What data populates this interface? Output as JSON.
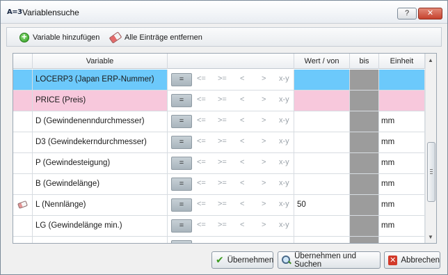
{
  "window": {
    "app_icon": "A=3",
    "title": "Variablensuche",
    "help_label": "?",
    "close_label": "✕"
  },
  "toolbar": {
    "add_label": "Variable hinzufügen",
    "add_icon": "add-circle-icon",
    "clear_label": "Alle Einträge entfernen",
    "clear_icon": "eraser-icon"
  },
  "grid": {
    "headers": {
      "variable": "Variable",
      "von": "Wert / von",
      "bis": "bis",
      "unit": "Einheit"
    },
    "ops": {
      "eq": "=",
      "le": "<=",
      "ge": ">=",
      "lt": "<",
      "gt": ">",
      "range": "x-y"
    },
    "rows": [
      {
        "variable": "LOCERP3 (Japan ERP-Nummer)",
        "von": "",
        "unit": "",
        "state": "selected"
      },
      {
        "variable": "PRICE (Preis)",
        "von": "",
        "unit": "",
        "state": "highlighted"
      },
      {
        "variable": "D (Gewindenenndurchmesser)",
        "von": "",
        "unit": "mm",
        "state": "normal"
      },
      {
        "variable": "D3 (Gewindekerndurchmesser)",
        "von": "",
        "unit": "mm",
        "state": "normal"
      },
      {
        "variable": "P (Gewindesteigung)",
        "von": "",
        "unit": "mm",
        "state": "normal"
      },
      {
        "variable": "B (Gewindelänge)",
        "von": "",
        "unit": "mm",
        "state": "normal"
      },
      {
        "variable": "L (Nennlänge)",
        "von": "50",
        "unit": "mm",
        "state": "normal",
        "icon": "eraser-icon"
      },
      {
        "variable": "LG (Gewindelänge min.)",
        "von": "",
        "unit": "mm",
        "state": "normal"
      }
    ]
  },
  "buttons": {
    "apply": "Übernehmen",
    "apply_search": "Übernehmen und Suchen",
    "cancel": "Abbrechen"
  },
  "colors": {
    "selected_row": "#6cc9fb",
    "highlighted_row": "#f7c8dc",
    "bis_column": "#9c9c9c"
  }
}
